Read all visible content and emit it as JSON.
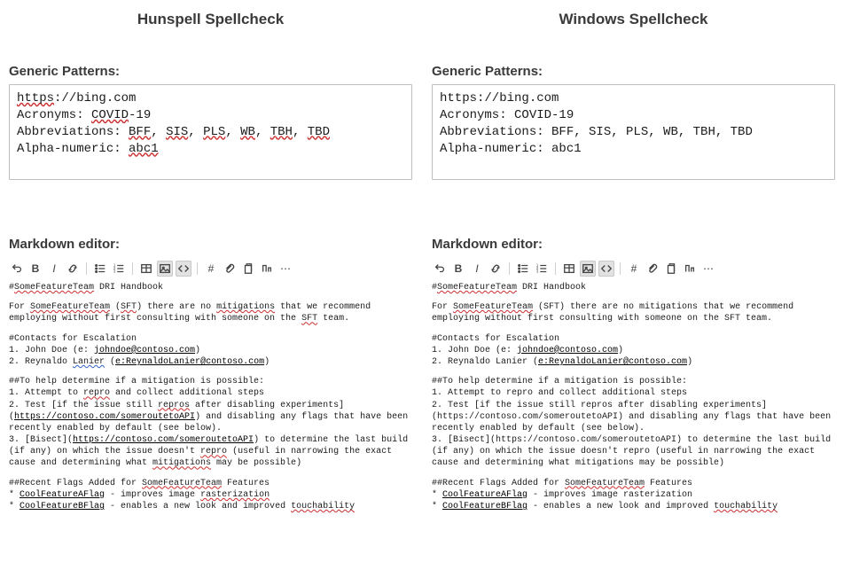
{
  "left": {
    "title": "Hunspell Spellcheck",
    "patterns_label": "Generic Patterns:",
    "markdown_label": "Markdown editor:",
    "patterns": {
      "url_pre": "https",
      "url_post": "://bing.com",
      "acro_label": "Acronyms: ",
      "acro_val": "COVID",
      "acro_post": "-19",
      "abbr_label": "Abbreviations: ",
      "abbr_vals": [
        "BFF",
        "SIS",
        "PLS",
        "WB",
        "TBH",
        "TBD"
      ],
      "an_label": "Alpha-numeric: ",
      "an_val": "abc1"
    },
    "md": {
      "line1_hash": "#",
      "line1_sft": "SomeFeatureTeam",
      "line1_post": " DRI Handbook",
      "p1_pre": "For ",
      "p1_sft": "SomeFeatureTeam",
      "p1_open": " (",
      "p1_sft2": "SFT",
      "p1_mid": ") there are no ",
      "p1_mit": "mitigations",
      "p1_post": " that we recommend employing without first consulting with someone on the ",
      "p1_sft3": "SFT",
      "p1_end": " team.",
      "contacts_hdr": "#Contacts for Escalation",
      "c1_pre": "1. John Doe (e: ",
      "c1_link": "johndoe@contoso.com",
      "c1_post": ")",
      "c2_pre": "2. Reynaldo ",
      "c2_lanier": "Lanier",
      "c2_mid": " (",
      "c2_link": "e:ReynaldoLanier@contoso.com",
      "c2_post": ")",
      "help_hdr": "##To help determine if a mitigation is possible:",
      "h1_pre": "1. Attempt to ",
      "h1_repro": "repro",
      "h1_post": " and collect additional steps",
      "h2_pre": "2. Test [if the issue still ",
      "h2_repros": "repros",
      "h2_mid": " after disabling experiments](",
      "h2_link": "https://contoso.com/someroutetoAPI",
      "h2_post": ") and disabling any flags that have been recently enabled by default (see below).",
      "h3_pre": "3. [Bisect](",
      "h3_link": "https://contoso.com/someroutetoAPI",
      "h3_mid": ") to determine the last build (if any) on which the issue doesn't ",
      "h3_repro": "repro",
      "h3_mid2": " (useful in narrowing the exact cause and determining what ",
      "h3_mit": "mitigations",
      "h3_post": " may be possible)",
      "flags_hdr_pre": "##Recent Flags Added for ",
      "flags_hdr_sft": "SomeFeatureTeam",
      "flags_hdr_post": " Features",
      "f1_pre": "* ",
      "f1_link": "CoolFeatureAFlag",
      "f1_mid": " - improves image ",
      "f1_rast": "rasterization",
      "f2_pre": "* ",
      "f2_link": "CoolFeatureBFlag",
      "f2_mid": " - enables a new look and improved ",
      "f2_touch": "touchability"
    }
  },
  "right": {
    "title": "Windows Spellcheck",
    "patterns_label": "Generic Patterns:",
    "markdown_label": "Markdown editor:",
    "patterns": {
      "url": "https://bing.com",
      "acro": "Acronyms: COVID-19",
      "abbr": "Abbreviations: BFF, SIS, PLS, WB, TBH, TBD",
      "an": "Alpha-numeric: abc1"
    },
    "md": {
      "line1_hash": "#",
      "line1_sft": "SomeFeatureTeam",
      "line1_post": " DRI Handbook",
      "p1_pre": "For ",
      "p1_sft": "SomeFeatureTeam",
      "p1_mid": " (SFT) there are no mitigations that we recommend employing without first consulting with someone on the SFT team.",
      "contacts_hdr": "#Contacts for Escalation",
      "c1_pre": "1. John Doe (e: ",
      "c1_link": "johndoe@contoso.com",
      "c1_post": ")",
      "c2_pre": "2. Reynaldo Lanier (",
      "c2_link": "e:ReynaldoLanier@contoso.com",
      "c2_post": ")",
      "help_hdr": "##To help determine if a mitigation is possible:",
      "h1": "1. Attempt to repro and collect additional steps",
      "h2": "2. Test [if the issue still repros after disabling experiments](https://contoso.com/someroutetoAPI) and disabling any flags that have been recently enabled by default (see below).",
      "h3": "3. [Bisect](https://contoso.com/someroutetoAPI) to determine the last build (if any) on which the issue doesn't repro (useful in narrowing the exact cause and determining what mitigations may be possible)",
      "flags_hdr_pre": "##Recent Flags Added for ",
      "flags_hdr_sft": "SomeFeatureTeam",
      "flags_hdr_post": " Features",
      "f1_pre": "* ",
      "f1_link": "CoolFeatureAFlag",
      "f1_post": " - improves image rasterization",
      "f2_pre": "* ",
      "f2_link": "CoolFeatureBFlag",
      "f2_mid": " - enables a new look and improved ",
      "f2_touch": "touchability"
    }
  }
}
